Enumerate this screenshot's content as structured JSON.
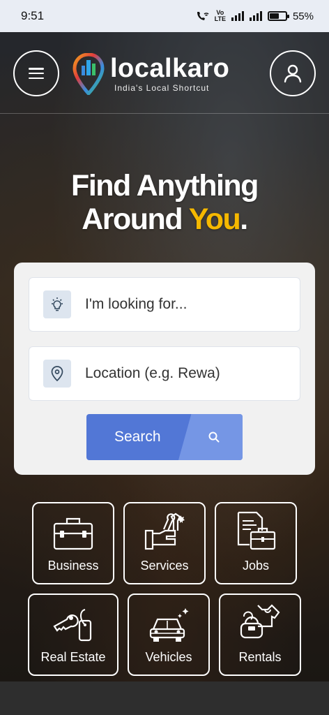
{
  "status_bar": {
    "time": "9:51",
    "volte_top": "Vo",
    "volte_bottom": "LTE",
    "battery": "55%"
  },
  "header": {
    "brand_name": "localkaro",
    "tagline": "India's Local Shortcut",
    "menu_icon": "hamburger-icon",
    "user_icon": "user-icon"
  },
  "headline": {
    "line1": "Find Anything",
    "line2_plain": "Around ",
    "line2_accent": "You",
    "line2_end": "."
  },
  "search": {
    "what_placeholder": "I'm looking for...",
    "location_placeholder": "Location (e.g. Rewa)",
    "button_label": "Search"
  },
  "categories": [
    {
      "label": "Business",
      "icon": "briefcase-icon"
    },
    {
      "label": "Services",
      "icon": "tools-icon"
    },
    {
      "label": "Jobs",
      "icon": "document-briefcase-icon"
    },
    {
      "label": "Real Estate",
      "icon": "key-tag-icon"
    },
    {
      "label": "Vehicles",
      "icon": "car-icon"
    },
    {
      "label": "Rentals",
      "icon": "clothes-icon"
    }
  ],
  "colors": {
    "accent": "#f5b800",
    "primary_button": "#5277d6",
    "primary_button_light": "#7596e5"
  }
}
